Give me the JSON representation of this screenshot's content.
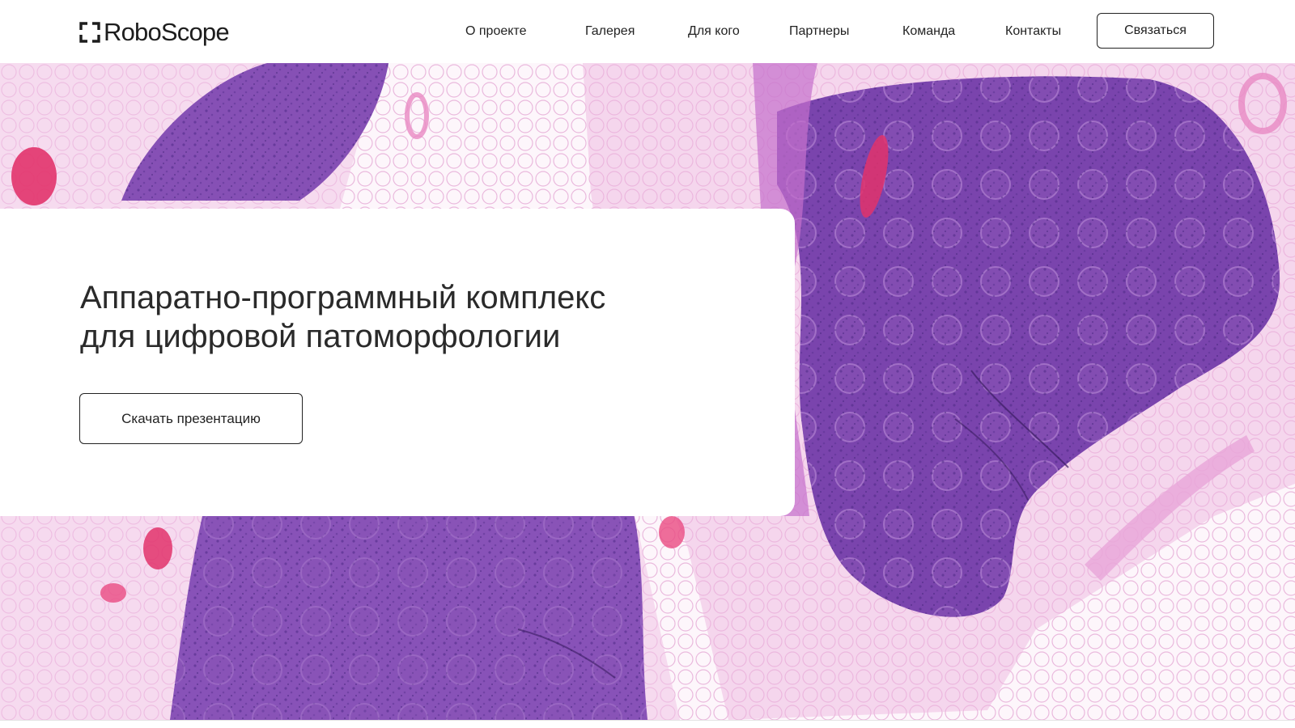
{
  "header": {
    "logo_text": "RoboScope",
    "nav": [
      {
        "label": "О проекте"
      },
      {
        "label": "Галерея"
      },
      {
        "label": "Для кого"
      },
      {
        "label": "Партнеры"
      },
      {
        "label": "Команда"
      },
      {
        "label": "Контакты"
      }
    ],
    "contact_label": "Связаться"
  },
  "hero": {
    "title_line1": "Аппаратно-программный комплекс",
    "title_line2": "для цифровой патоморфологии",
    "download_label": "Скачать презентацию",
    "background": "histology-tissue-slide-image"
  },
  "colors": {
    "tissue_dark": "#6b3fa0",
    "tissue_mid": "#9457b8",
    "tissue_light": "#e6b4dd",
    "vessel": "#e2336b",
    "text": "#222222"
  }
}
